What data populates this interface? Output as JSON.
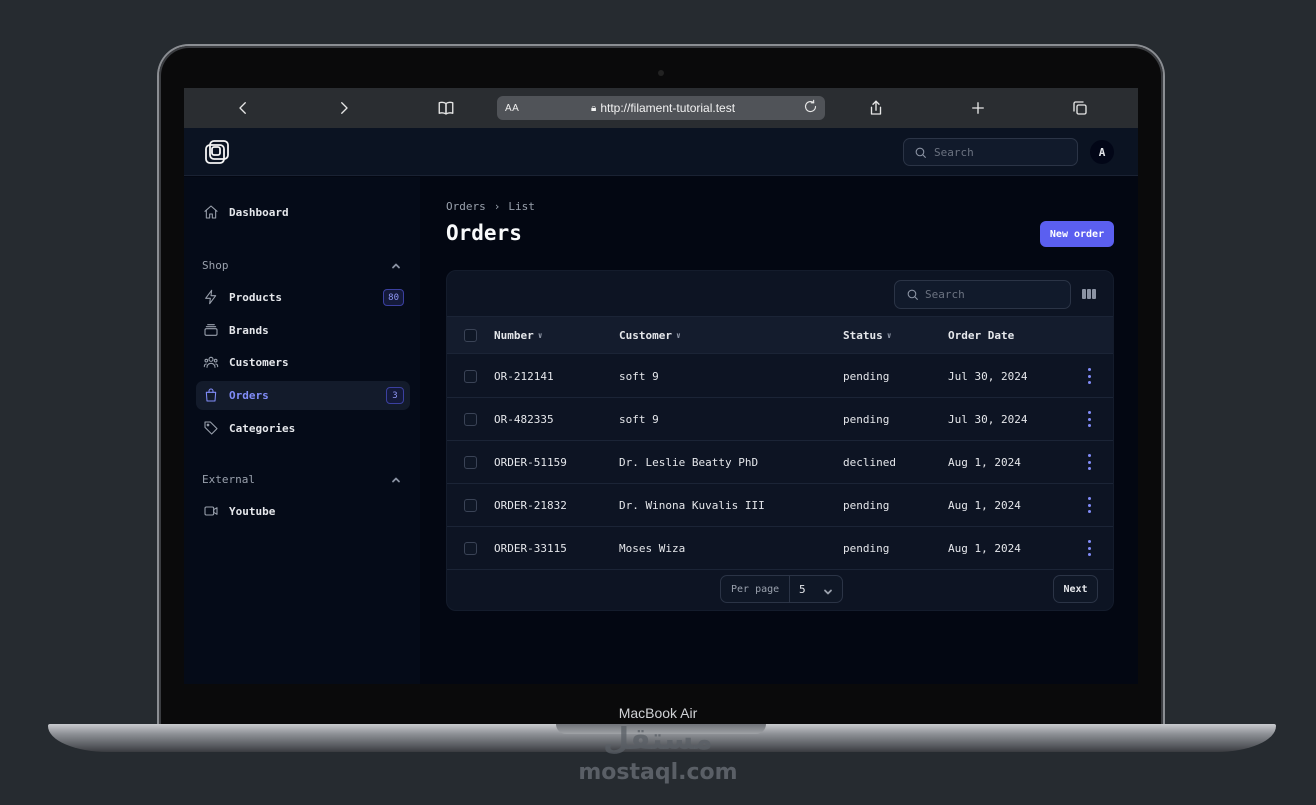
{
  "device": {
    "label": "MacBook Air"
  },
  "watermark": {
    "arabic": "مستقل",
    "latin": "mostaql.com"
  },
  "browser": {
    "aa_label": "AA",
    "url": "http://filament-tutorial.test",
    "icons": [
      "back-icon",
      "forward-icon",
      "bookmarks-icon",
      "reload-icon",
      "share-icon",
      "new-tab-icon",
      "tabs-icon"
    ]
  },
  "topbar": {
    "search_placeholder": "Search",
    "avatar_initial": "A"
  },
  "sidebar": {
    "dashboard": {
      "label": "Dashboard"
    },
    "groups": [
      {
        "label": "Shop"
      },
      {
        "label": "External"
      }
    ],
    "items": [
      {
        "label": "Products",
        "badge": "80"
      },
      {
        "label": "Brands"
      },
      {
        "label": "Customers"
      },
      {
        "label": "Orders",
        "badge": "3",
        "active": true
      },
      {
        "label": "Categories"
      },
      {
        "label": "Youtube"
      }
    ]
  },
  "main": {
    "breadcrumb": [
      "Orders",
      "List"
    ],
    "title": "Orders",
    "new_button": "New order",
    "table": {
      "search_placeholder": "Search",
      "columns": [
        "Number",
        "Customer",
        "Status",
        "Order Date"
      ],
      "rows": [
        {
          "number": "OR-212141",
          "customer": "soft 9",
          "status": "pending",
          "date": "Jul 30, 2024"
        },
        {
          "number": "OR-482335",
          "customer": "soft 9",
          "status": "pending",
          "date": "Jul 30, 2024"
        },
        {
          "number": "ORDER-51159",
          "customer": "Dr. Leslie Beatty PhD",
          "status": "declined",
          "date": "Aug 1, 2024"
        },
        {
          "number": "ORDER-21832",
          "customer": "Dr. Winona Kuvalis III",
          "status": "pending",
          "date": "Aug 1, 2024"
        },
        {
          "number": "ORDER-33115",
          "customer": "Moses Wiza",
          "status": "pending",
          "date": "Aug 1, 2024"
        }
      ],
      "per_page_label": "Per page",
      "per_page_value": "5",
      "next_label": "Next"
    }
  },
  "colors": {
    "accent": "#5b5ff0",
    "accent_text": "#818cf8",
    "background": "#030712"
  }
}
